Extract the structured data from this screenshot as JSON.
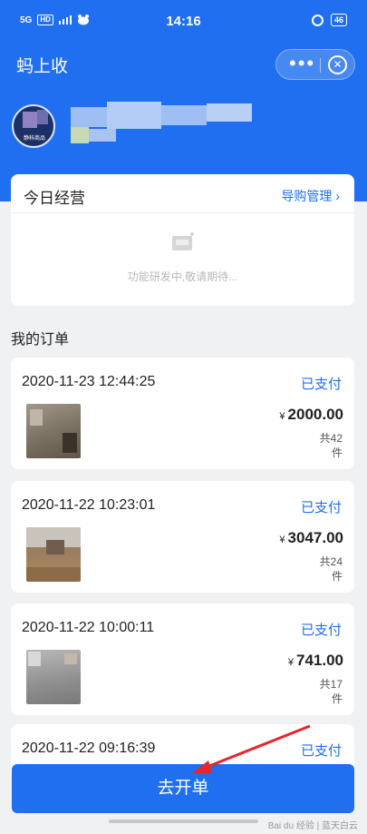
{
  "status_bar": {
    "signal": "5G",
    "hd": "HD",
    "time": "14:16",
    "battery": "46"
  },
  "header": {
    "app_title": "蚂上收",
    "more_label": "•••",
    "close_label": "✕",
    "avatar_caption": "静科商品"
  },
  "today": {
    "title": "今日经营",
    "link_label": "导购管理 ›",
    "dev_message": "功能研发中,敬请期待..."
  },
  "orders": {
    "section_title": "我的订单",
    "currency": "¥",
    "qty_prefix": "共",
    "qty_suffix": "件",
    "items": [
      {
        "datetime": "2020-11-23 12:44:25",
        "status": "已支付",
        "price": "2000.00",
        "qty": "42"
      },
      {
        "datetime": "2020-11-22 10:23:01",
        "status": "已支付",
        "price": "3047.00",
        "qty": "24"
      },
      {
        "datetime": "2020-11-22 10:00:11",
        "status": "已支付",
        "price": "741.00",
        "qty": "17"
      },
      {
        "datetime": "2020-11-22 09:16:39",
        "status": "已支付"
      }
    ]
  },
  "bottom_button": "去开单",
  "watermark": "Bai du 经验 | 蓝天白云"
}
